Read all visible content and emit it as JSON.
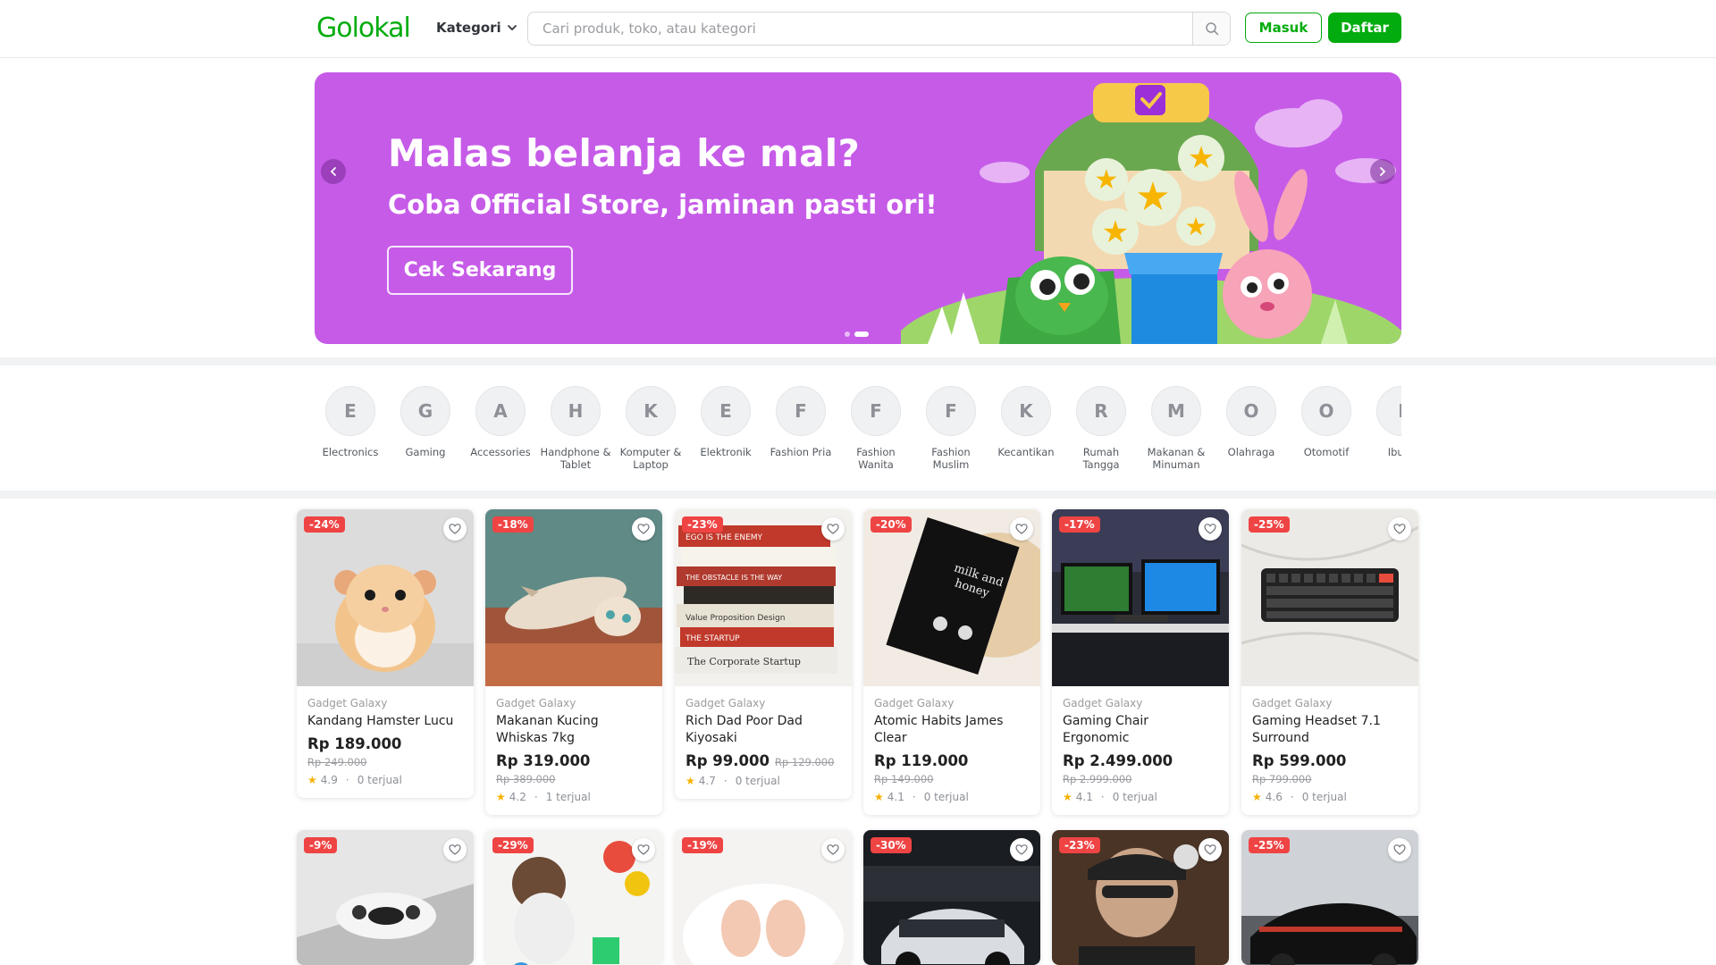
{
  "header": {
    "logo": "Golokal",
    "kategori_label": "Kategori",
    "search_placeholder": "Cari produk, toko, atau kategori",
    "login_label": "Masuk",
    "register_label": "Daftar"
  },
  "banner": {
    "title": "Malas belanja ke mal?",
    "subtitle": "Coba Official Store, jaminan pasti ori!",
    "cta": "Cek Sekarang",
    "slides": 2,
    "active_slide": 2,
    "bg_color": "#c65be8"
  },
  "categories": [
    {
      "letter": "E",
      "label": "Electronics"
    },
    {
      "letter": "G",
      "label": "Gaming"
    },
    {
      "letter": "A",
      "label": "Accessories"
    },
    {
      "letter": "H",
      "label": "Handphone & Tablet"
    },
    {
      "letter": "K",
      "label": "Komputer & Laptop"
    },
    {
      "letter": "E",
      "label": "Elektronik"
    },
    {
      "letter": "F",
      "label": "Fashion Pria"
    },
    {
      "letter": "F",
      "label": "Fashion Wanita"
    },
    {
      "letter": "F",
      "label": "Fashion Muslim"
    },
    {
      "letter": "K",
      "label": "Kecantikan"
    },
    {
      "letter": "R",
      "label": "Rumah Tangga"
    },
    {
      "letter": "M",
      "label": "Makanan & Minuman"
    },
    {
      "letter": "O",
      "label": "Olahraga"
    },
    {
      "letter": "O",
      "label": "Otomotif"
    },
    {
      "letter": "I",
      "label": "Ibu &"
    }
  ],
  "products": [
    {
      "discount": "-24%",
      "shop": "Gadget Galaxy",
      "name": "Kandang Hamster Lucu",
      "price": "Rp 189.000",
      "old_price": "Rp 249.000",
      "rating": "4.9",
      "sold": "0 terjual",
      "image": "hamster"
    },
    {
      "discount": "-18%",
      "shop": "Gadget Galaxy",
      "name": "Makanan Kucing Whiskas 7kg",
      "price": "Rp 319.000",
      "old_price": "Rp 389.000",
      "rating": "4.2",
      "sold": "1 terjual",
      "image": "cat"
    },
    {
      "discount": "-23%",
      "shop": "Gadget Galaxy",
      "name": "Rich Dad Poor Dad Kiyosaki",
      "price": "Rp 99.000",
      "old_price": "Rp 129.000",
      "rating": "4.7",
      "sold": "0 terjual",
      "image": "books"
    },
    {
      "discount": "-20%",
      "shop": "Gadget Galaxy",
      "name": "Atomic Habits James Clear",
      "price": "Rp 119.000",
      "old_price": "Rp 149.000",
      "rating": "4.1",
      "sold": "0 terjual",
      "image": "book-dark"
    },
    {
      "discount": "-17%",
      "shop": "Gadget Galaxy",
      "name": "Gaming Chair Ergonomic",
      "price": "Rp 2.499.000",
      "old_price": "Rp 2.999.000",
      "rating": "4.1",
      "sold": "0 terjual",
      "image": "gaming-setup"
    },
    {
      "discount": "-25%",
      "shop": "Gadget Galaxy",
      "name": "Gaming Headset 7.1 Surround",
      "price": "Rp 599.000",
      "old_price": "Rp 799.000",
      "rating": "4.6",
      "sold": "0 terjual",
      "image": "keyboard"
    },
    {
      "discount": "-9%",
      "image": "console"
    },
    {
      "discount": "-29%",
      "image": "toddler"
    },
    {
      "discount": "-19%",
      "image": "baby-feet"
    },
    {
      "discount": "-30%",
      "image": "sports-car"
    },
    {
      "discount": "-23%",
      "image": "mechanic"
    },
    {
      "discount": "-25%",
      "image": "black-car"
    }
  ]
}
